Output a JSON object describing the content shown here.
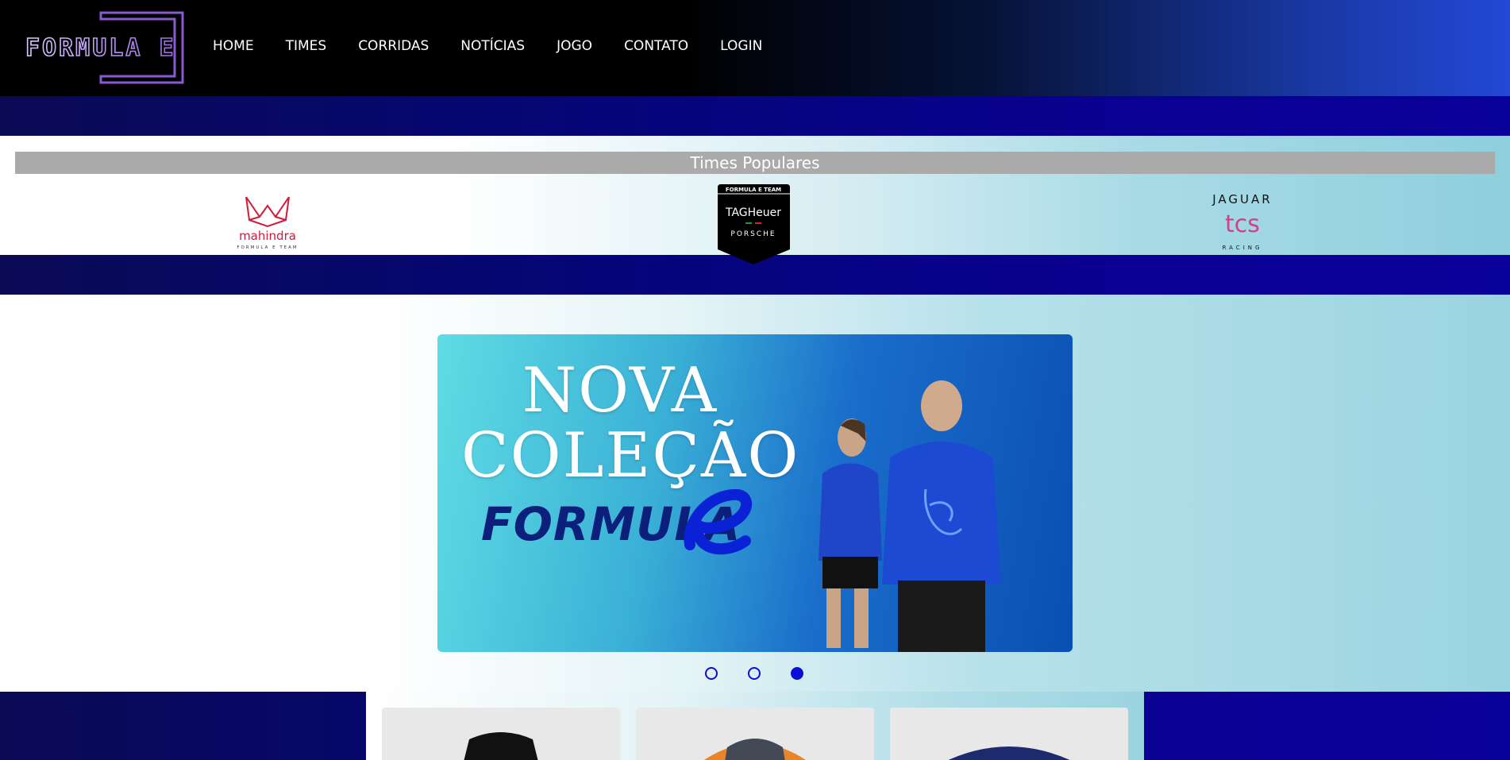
{
  "header": {
    "logo_text": "FORMULA E",
    "nav": [
      {
        "label": "HOME"
      },
      {
        "label": "TIMES"
      },
      {
        "label": "CORRIDAS"
      },
      {
        "label": "NOTÍCIAS"
      },
      {
        "label": "JOGO"
      },
      {
        "label": "CONTATO"
      },
      {
        "label": "LOGIN"
      }
    ]
  },
  "teams": {
    "title": "Times Populares",
    "items": [
      {
        "name": "mahindra",
        "subtitle": "FORMULA E TEAM"
      },
      {
        "name": "TAG Heuer Porsche",
        "top": "FORMULA E TEAM",
        "line1": "TAGHeuer",
        "line2": "PORSCHE"
      },
      {
        "name": "JAGUAR",
        "line2": "tcs",
        "line3": "RACING"
      }
    ]
  },
  "carousel": {
    "slide_title_line1": "NOVA",
    "slide_title_line2": "COLEÇÃO",
    "slide_brand": "FORMULA",
    "dots": [
      false,
      false,
      true
    ]
  },
  "colors": {
    "nav_text": "#ffffff",
    "band": "#050578",
    "dot": "#0a10d8",
    "teams_title_bg": "#aaaaaa"
  }
}
